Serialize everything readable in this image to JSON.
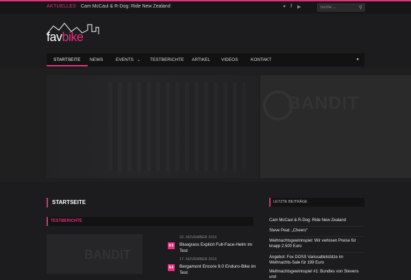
{
  "topbar": {
    "label": "AKTUELLES",
    "headline": "Cam McCaul & R-Dog: Ride New Zealand",
    "social": [
      "rss-icon",
      "facebook-icon",
      "youtube-icon"
    ],
    "search_placeholder": "Suche ..."
  },
  "logo": {
    "part1": "fav",
    "part2": "bike"
  },
  "nav": {
    "items": [
      "STARTSEITE",
      "NEWS",
      "EVENTS",
      "TESTBERICHTE",
      "ARTIKEL",
      "VIDEOS",
      "KONTAKT"
    ],
    "events_chevron": "⌄"
  },
  "hero": {
    "right_banner": "BANDIT"
  },
  "main": {
    "title": "STARTSEITE",
    "category": "TESTBERICHTE",
    "feature_banner": "BANDIT",
    "posts": [
      {
        "date": "22. NOVEMBER 2015",
        "badge": "8.6",
        "title": "Bluegrass Explicit Full-Face-Helm im Test"
      },
      {
        "date": "17. NOVEMBER 2015",
        "badge": "8.6",
        "title": "Bergamont Encore 9.0 Enduro-Bike im Test"
      }
    ]
  },
  "sidebar": {
    "heading": "LETZTE BEITRÄGE",
    "items": [
      "Cam McCaul & R-Dog: Ride New Zealand",
      "Steve Peat: „Cheers“",
      "Weihnachtsgewinnspiel: Wir verlosen Preise für knapp 2.500 Euro",
      "Angebot: Fox DOSS Variosattelstütze im Weihnachts-Sale für 199 Euro",
      "Weihnachtsgewinnspiel #1: Bundles von Stevens und"
    ]
  },
  "colors": {
    "accent": "#e5307e",
    "background": "#1c1c1e",
    "bar": "#121213"
  }
}
